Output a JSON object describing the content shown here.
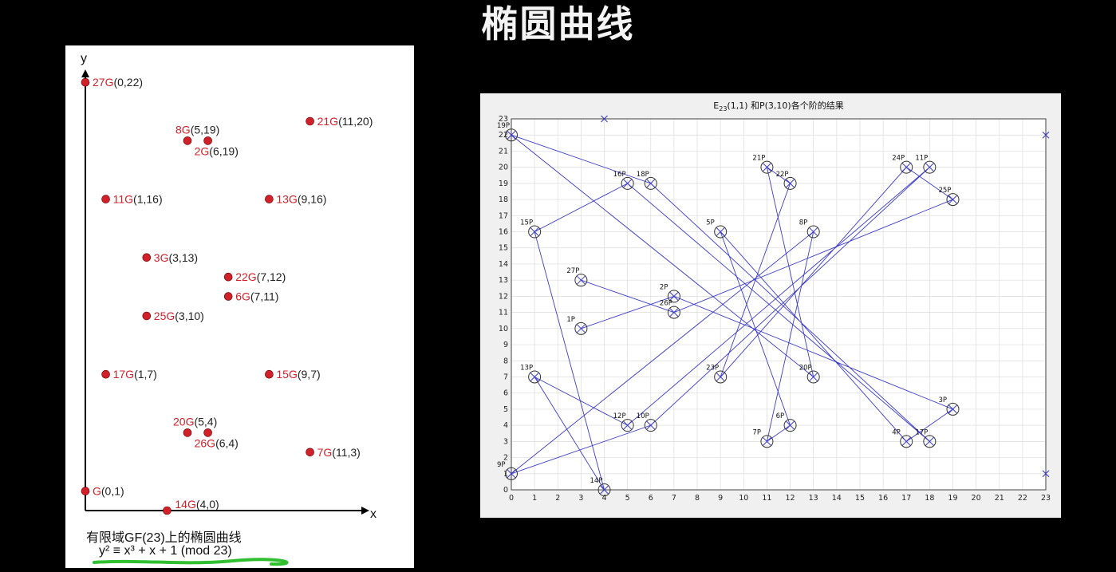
{
  "slide": {
    "title": "椭圆曲线"
  },
  "left_panel": {
    "caption_line1": "有限域GF(23)上的椭圆曲线",
    "caption_line2": "y² ≡ x³ + x + 1 (mod 23)",
    "axis_x_label": "x",
    "axis_y_label": "y",
    "colors": {
      "point": "#d0202a",
      "label": "#d0202a",
      "axis": "#000000",
      "underline": "#2fbf2f"
    }
  },
  "chart_data": [
    {
      "type": "scatter",
      "title": "",
      "xlabel": "x",
      "ylabel": "y",
      "xlim": [
        0,
        12
      ],
      "ylim": [
        0,
        22
      ],
      "grid": false,
      "points": [
        {
          "label": "27G",
          "coord": "(0,22)",
          "x": 0,
          "y": 22
        },
        {
          "label": "21G",
          "coord": "(11,20)",
          "x": 11,
          "y": 20
        },
        {
          "label": "8G",
          "coord": "(5,19)",
          "x": 5,
          "y": 19
        },
        {
          "label": "2G",
          "coord": "(6,19)",
          "x": 6,
          "y": 19
        },
        {
          "label": "11G",
          "coord": "(1,16)",
          "x": 1,
          "y": 16
        },
        {
          "label": "13G",
          "coord": "(9,16)",
          "x": 9,
          "y": 16
        },
        {
          "label": "3G",
          "coord": "(3,13)",
          "x": 3,
          "y": 13
        },
        {
          "label": "22G",
          "coord": "(7,12)",
          "x": 7,
          "y": 12
        },
        {
          "label": "6G",
          "coord": "(7,11)",
          "x": 7,
          "y": 11
        },
        {
          "label": "25G",
          "coord": "(3,10)",
          "x": 3,
          "y": 10
        },
        {
          "label": "17G",
          "coord": "(1,7)",
          "x": 1,
          "y": 7
        },
        {
          "label": "15G",
          "coord": "(9,7)",
          "x": 9,
          "y": 7
        },
        {
          "label": "20G",
          "coord": "(5,4)",
          "x": 5,
          "y": 4
        },
        {
          "label": "26G",
          "coord": "(6,4)",
          "x": 6,
          "y": 4
        },
        {
          "label": "7G",
          "coord": "(11,3)",
          "x": 11,
          "y": 3
        },
        {
          "label": "G",
          "coord": "(0,1)",
          "x": 0,
          "y": 1
        },
        {
          "label": "14G",
          "coord": "(4,0)",
          "x": 4,
          "y": 0
        }
      ]
    },
    {
      "type": "line",
      "title": "E23(1,1) 和P(3,10)各个阶的结果",
      "title_prefix": "E",
      "title_sub": "23",
      "title_suffix": "(1,1) 和P(3,10)各个阶的结果",
      "xlabel": "",
      "ylabel": "",
      "xlim": [
        0,
        23
      ],
      "ylim": [
        0,
        23
      ],
      "grid": true,
      "xticks": [
        0,
        1,
        2,
        3,
        4,
        5,
        6,
        7,
        8,
        9,
        10,
        11,
        12,
        13,
        14,
        15,
        16,
        17,
        18,
        19,
        20,
        21,
        22,
        23
      ],
      "yticks": [
        0,
        1,
        2,
        3,
        4,
        5,
        6,
        7,
        8,
        9,
        10,
        11,
        12,
        13,
        14,
        15,
        16,
        17,
        18,
        19,
        20,
        21,
        22,
        23
      ],
      "series_color": "#3c3cc8",
      "points": [
        {
          "label": "1P",
          "x": 3,
          "y": 10
        },
        {
          "label": "2P",
          "x": 7,
          "y": 12
        },
        {
          "label": "3P",
          "x": 19,
          "y": 5
        },
        {
          "label": "4P",
          "x": 17,
          "y": 3
        },
        {
          "label": "5P",
          "x": 9,
          "y": 16
        },
        {
          "label": "6P",
          "x": 12,
          "y": 4
        },
        {
          "label": "7P",
          "x": 11,
          "y": 3
        },
        {
          "label": "8P",
          "x": 13,
          "y": 16
        },
        {
          "label": "9P",
          "x": 0,
          "y": 1
        },
        {
          "label": "10P",
          "x": 6,
          "y": 4
        },
        {
          "label": "11P",
          "x": 18,
          "y": 20
        },
        {
          "label": "12P",
          "x": 5,
          "y": 4
        },
        {
          "label": "13P",
          "x": 1,
          "y": 7
        },
        {
          "label": "14P",
          "x": 4,
          "y": 0
        },
        {
          "label": "15P",
          "x": 1,
          "y": 16
        },
        {
          "label": "16P",
          "x": 5,
          "y": 19
        },
        {
          "label": "17P",
          "x": 18,
          "y": 3
        },
        {
          "label": "18P",
          "x": 6,
          "y": 19
        },
        {
          "label": "19P",
          "x": 0,
          "y": 22
        },
        {
          "label": "20P",
          "x": 13,
          "y": 7
        },
        {
          "label": "21P",
          "x": 11,
          "y": 20
        },
        {
          "label": "22P",
          "x": 12,
          "y": 19
        },
        {
          "label": "23P",
          "x": 9,
          "y": 7
        },
        {
          "label": "24P",
          "x": 17,
          "y": 20
        },
        {
          "label": "25P",
          "x": 19,
          "y": 18
        },
        {
          "label": "26P",
          "x": 7,
          "y": 11
        },
        {
          "label": "27P",
          "x": 3,
          "y": 13
        }
      ],
      "extra_markers": [
        {
          "x": 4,
          "y": 23
        },
        {
          "x": 23,
          "y": 22
        },
        {
          "x": 23,
          "y": 1
        }
      ]
    }
  ]
}
